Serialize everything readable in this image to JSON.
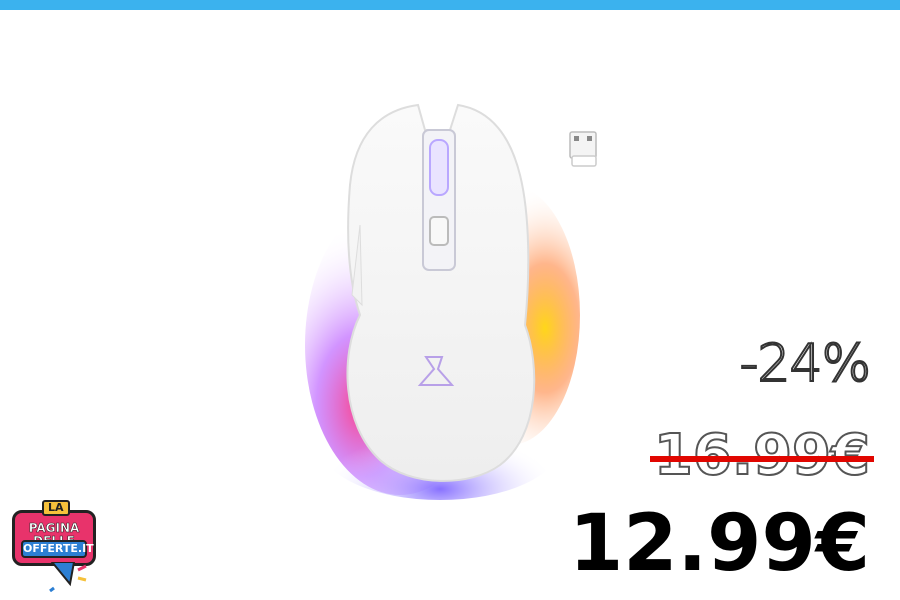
{
  "colors": {
    "top_bar": "#3bb2ee",
    "strike_line": "#e10600",
    "price_text": "#000000",
    "logo_pink": "#e8336b",
    "logo_blue": "#2c7fd3",
    "logo_yellow": "#f6c13b"
  },
  "product": {
    "image_icon": "wireless-gaming-mouse-rgb-icon",
    "accessory_icon": "usb-dongle-icon"
  },
  "pricing": {
    "discount": "-24%",
    "old_price": "16.99€",
    "new_price": "12.99€"
  },
  "logo": {
    "top": "LA",
    "line1": "PAGINA DELLE",
    "line2": "OFFERTE.IT"
  }
}
